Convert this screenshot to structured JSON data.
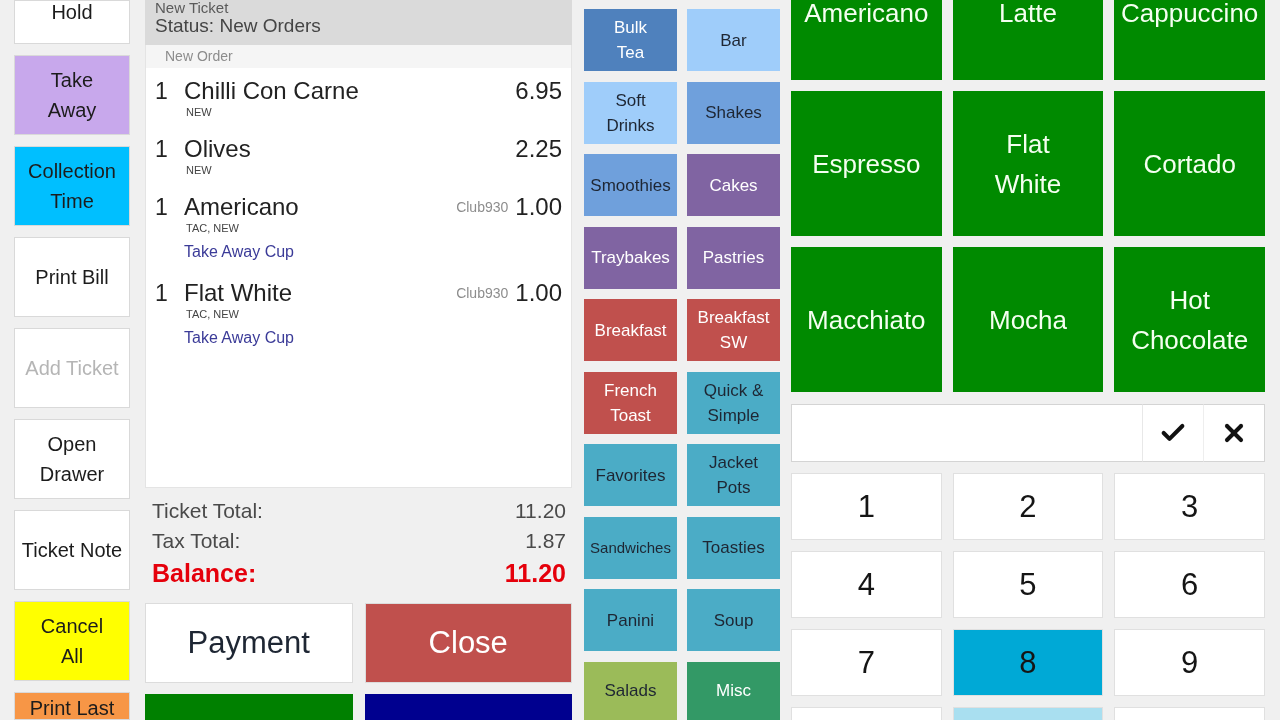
{
  "action_buttons": [
    {
      "label": "Hold",
      "color": "#ffffff",
      "disabled": false
    },
    {
      "label": "Take\nAway",
      "color": "#c8a8ec",
      "disabled": false
    },
    {
      "label": "Collection\nTime",
      "color": "#00bfff",
      "disabled": false
    },
    {
      "label": "Print Bill",
      "color": "#ffffff",
      "disabled": false
    },
    {
      "label": "Add Ticket",
      "color": "#ffffff",
      "disabled": true
    },
    {
      "label": "Open\nDrawer",
      "color": "#ffffff",
      "disabled": false
    },
    {
      "label": "Ticket Note",
      "color": "#ffffff",
      "disabled": false
    },
    {
      "label": "Cancel\nAll",
      "color": "#ffff00",
      "disabled": false
    },
    {
      "label": "Print Last",
      "color": "#f79646",
      "disabled": false
    }
  ],
  "ticket": {
    "title": "New Ticket",
    "status": "Status: New Orders",
    "group_label": "New Order",
    "items": [
      {
        "quantity": "1",
        "name": "Chilli Con Carne",
        "tags": "NEW",
        "price": "6.95"
      },
      {
        "quantity": "1",
        "name": "Olives",
        "tags": "NEW",
        "price": "2.25"
      },
      {
        "quantity": "1",
        "name": "Americano",
        "tags": "TAC, NEW",
        "account": "Club930",
        "price": "1.00",
        "modifiers": [
          "Take Away Cup"
        ]
      },
      {
        "quantity": "1",
        "name": "Flat White",
        "tags": "TAC, NEW",
        "account": "Club930",
        "price": "1.00",
        "modifiers": [
          "Take Away Cup"
        ]
      }
    ]
  },
  "totals": [
    {
      "kind": "normal",
      "label": "Ticket Total:",
      "value": "11.20"
    },
    {
      "kind": "normal",
      "label": "Tax Total:",
      "value": "1.87"
    },
    {
      "kind": "balance",
      "label": "Balance:",
      "value": "11.20"
    }
  ],
  "payment_buttons": [
    {
      "label": "Payment",
      "color": "#ffffff"
    },
    {
      "label": "Close",
      "color": "#c0504d"
    }
  ],
  "bottom_buttons": [
    {
      "color": "#008000"
    },
    {
      "color": "#00008f"
    }
  ],
  "categories": [
    {
      "label": "Bulk\nTea",
      "color": "#4f81bd"
    },
    {
      "label": "Soft\nDrinks",
      "color": "#9fcdfa"
    },
    {
      "label": "Smoothies",
      "color": "#6fa0dc"
    },
    {
      "label": "Traybakes",
      "color": "#8064a2"
    },
    {
      "label": "Breakfast",
      "color": "#c0504d"
    },
    {
      "label": "French\nToast",
      "color": "#c0504d"
    },
    {
      "label": "Favorites",
      "color": "#4bacc6"
    },
    {
      "label": "Sandwiches",
      "color": "#4bacc6"
    },
    {
      "label": "Panini",
      "color": "#4bacc6"
    },
    {
      "label": "Salads",
      "color": "#9bbb59"
    },
    {
      "label": "Bar",
      "color": "#9fcdfa"
    },
    {
      "label": "Shakes",
      "color": "#6fa0dc"
    },
    {
      "label": "Cakes",
      "color": "#8064a2"
    },
    {
      "label": "Pastries",
      "color": "#8064a2"
    },
    {
      "label": "Breakfast\nSW",
      "color": "#c0504d"
    },
    {
      "label": "Quick &\nSimple",
      "color": "#4bacc6"
    },
    {
      "label": "Jacket\nPots",
      "color": "#4bacc6"
    },
    {
      "label": "Toasties",
      "color": "#4bacc6"
    },
    {
      "label": "Soup",
      "color": "#4bacc6"
    },
    {
      "label": "Misc",
      "color": "#339966"
    }
  ],
  "products": [
    "Americano",
    "Latte",
    "Cappuccino",
    "Espresso",
    "Flat\nWhite",
    "Cortado",
    "Macchiato",
    "Mocha",
    "Hot\nChocolate"
  ],
  "numpad": {
    "keys": [
      {
        "label": "1",
        "selected": false
      },
      {
        "label": "2",
        "selected": false
      },
      {
        "label": "3",
        "selected": false
      },
      {
        "label": "4",
        "selected": false
      },
      {
        "label": "5",
        "selected": false
      },
      {
        "label": "6",
        "selected": false
      },
      {
        "label": "7",
        "selected": false
      },
      {
        "label": "8",
        "selected": true
      },
      {
        "label": "9",
        "selected": false
      }
    ],
    "partial_keys": [
      {
        "highlighted": false
      },
      {
        "highlighted": true
      },
      {
        "highlighted": false
      }
    ]
  }
}
